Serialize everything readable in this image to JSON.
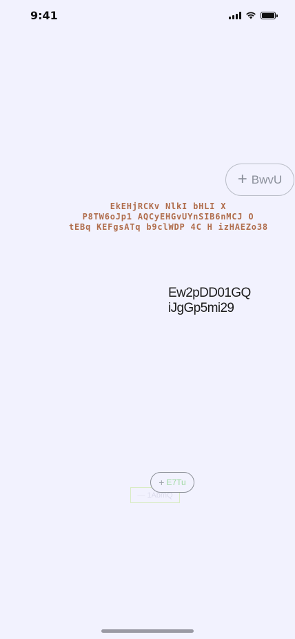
{
  "status_bar": {
    "time": "9:41"
  },
  "primary_button": {
    "label": "BwvU",
    "icon": "plus-icon"
  },
  "heading_lines": [
    "EkEHjRCKv NlkI bHLI X",
    "P8TW6oJp1 AQCyEHGvUYnSIB6nMCJ O",
    "tEBq KEFgsATq b9clWDP 4C  H izHAEZo38"
  ],
  "text_block": {
    "line1": "Ew2pDD01GQ",
    "line2": "iJgGp5mi29"
  },
  "small_button": {
    "label": "E7Tu",
    "icon": "plus-icon"
  },
  "ghost_field": {
    "label": "1AbmQ"
  },
  "colors": {
    "background": "#f2f2fe",
    "heading": "#b06d4c",
    "small_button_text": "#9fd9a2"
  }
}
